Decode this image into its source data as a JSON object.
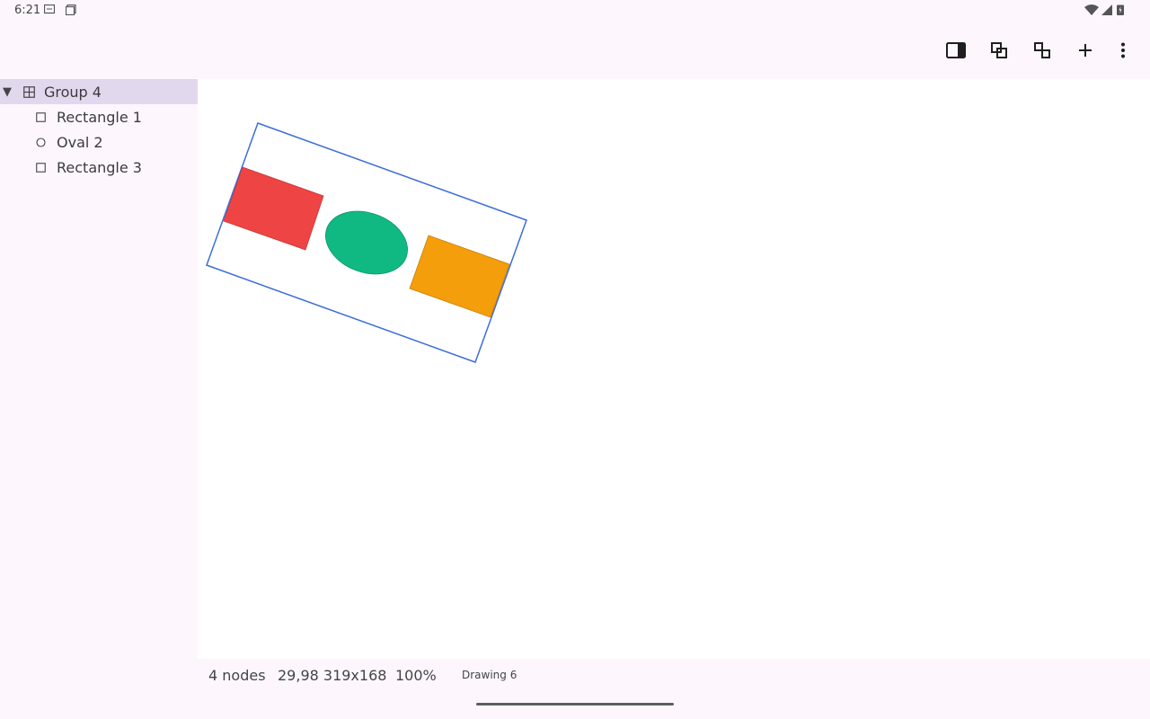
{
  "status_bar": {
    "time": "6:21",
    "icons": [
      "message-icon",
      "screen-icon",
      "wifi-icon",
      "signal-icon",
      "battery-icon"
    ]
  },
  "toolbar": {
    "buttons": [
      {
        "name": "panel-toggle-icon"
      },
      {
        "name": "group-icon"
      },
      {
        "name": "ungroup-icon"
      },
      {
        "name": "add-icon"
      },
      {
        "name": "more-vert-icon"
      }
    ]
  },
  "layers": [
    {
      "label": "Group 4",
      "icon": "group-grid-icon",
      "expanded": true,
      "selected": true,
      "depth": 0
    },
    {
      "label": "Rectangle 1",
      "icon": "rectangle-icon",
      "selected": false,
      "depth": 1
    },
    {
      "label": "Oval 2",
      "icon": "oval-icon",
      "selected": false,
      "depth": 1
    },
    {
      "label": "Rectangle 3",
      "icon": "rectangle-icon",
      "selected": false,
      "depth": 1
    }
  ],
  "canvas": {
    "selection_color": "#3b6fd8",
    "shapes": [
      {
        "name": "Rectangle 1",
        "fill": "#ef4444"
      },
      {
        "name": "Oval 2",
        "fill": "#10b981"
      },
      {
        "name": "Rectangle 3",
        "fill": "#f59e0b"
      }
    ]
  },
  "footer": {
    "nodes": "4 nodes",
    "geometry": "29,98 319x168",
    "zoom": "100%",
    "document": "Drawing 6"
  }
}
